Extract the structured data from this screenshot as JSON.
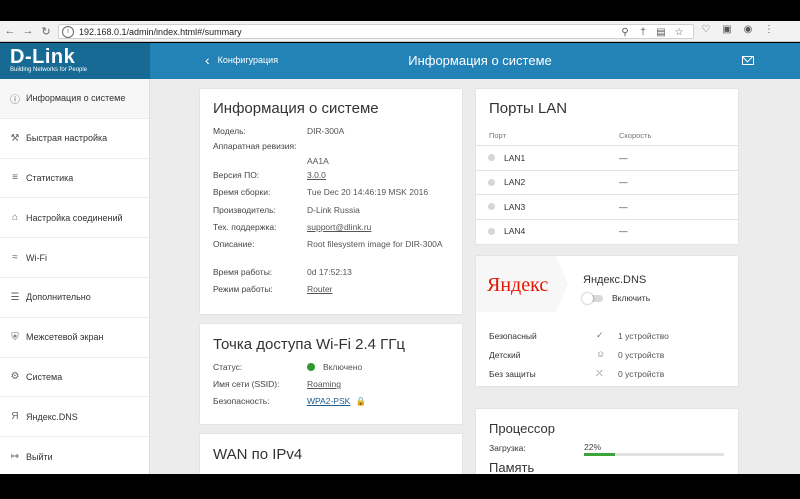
{
  "browser": {
    "url": "192.168.0.1/admin/index.html#/summary"
  },
  "header": {
    "brand": "D-Link",
    "tagline": "Building Networks for People",
    "back_label": "Конфигурация",
    "title": "Информация о системе"
  },
  "sidebar": {
    "items": [
      {
        "label": "Информация о системе",
        "icon": "info-icon"
      },
      {
        "label": "Быстрая настройка",
        "icon": "wizard-icon"
      },
      {
        "label": "Статистика",
        "icon": "statistics-icon"
      },
      {
        "label": "Настройка соединений",
        "icon": "connections-icon"
      },
      {
        "label": "Wi-Fi",
        "icon": "wifi-icon"
      },
      {
        "label": "Дополнительно",
        "icon": "sliders-icon"
      },
      {
        "label": "Межсетевой экран",
        "icon": "shield-icon"
      },
      {
        "label": "Система",
        "icon": "gear-icon"
      },
      {
        "label": "Яндекс.DNS",
        "icon": "yandex-icon"
      },
      {
        "label": "Выйти",
        "icon": "logout-icon"
      }
    ]
  },
  "system_info": {
    "title": "Информация о системе",
    "rows": [
      {
        "k": "Модель:",
        "v": "DIR-300A"
      },
      {
        "k": "Аппаратная ревизия:",
        "v": "AA1A"
      },
      {
        "k": "Версия ПО:",
        "v": "3.0.0"
      },
      {
        "k": "Время сборки:",
        "v": "Tue Dec 20 14:46:19 MSK 2016"
      },
      {
        "k": "Производитель:",
        "v": "D-Link Russia"
      },
      {
        "k": "Тех. поддержка:",
        "v": "support@dlink.ru"
      },
      {
        "k": "Описание:",
        "v": "Root filesystem image for DIR-300A"
      },
      {
        "k": "Время работы:",
        "v": "0d 17:52:13"
      },
      {
        "k": "Режим работы:",
        "v": "Router"
      }
    ]
  },
  "wifi": {
    "title": "Точка доступа Wi-Fi 2.4 ГГц",
    "status_label": "Статус:",
    "status_value": "Включено",
    "status_color": "#2f9a2f",
    "ssid_label": "Имя сети (SSID):",
    "ssid_value": "Roaming",
    "security_label": "Безопасность:",
    "security_value": "WPA2-PSK"
  },
  "wan": {
    "title": "WAN по IPv4"
  },
  "lan": {
    "title": "Порты LAN",
    "col_port": "Порт",
    "col_speed": "Скорость",
    "ports": [
      {
        "name": "LAN1",
        "speed": "—"
      },
      {
        "name": "LAN2",
        "speed": "—"
      },
      {
        "name": "LAN3",
        "speed": "—"
      },
      {
        "name": "LAN4",
        "speed": "—"
      }
    ]
  },
  "yandex": {
    "logo_text": "Яндекс",
    "title": "Яндекс.DNS",
    "toggle_label": "Включить",
    "toggle_on": false,
    "modes": [
      {
        "label": "Безопасный",
        "value": "1 устройство",
        "icon": "shield-check-icon"
      },
      {
        "label": "Детский",
        "value": "0 устройств",
        "icon": "child-icon"
      },
      {
        "label": "Без защиты",
        "value": "0 устройств",
        "icon": "shield-off-icon"
      }
    ]
  },
  "cpu": {
    "title": "Процессор",
    "load_label": "Загрузка:",
    "load_value": "22%",
    "load_fraction": 0.22,
    "bar_color": "#3aa63a"
  },
  "memory": {
    "title": "Память"
  }
}
